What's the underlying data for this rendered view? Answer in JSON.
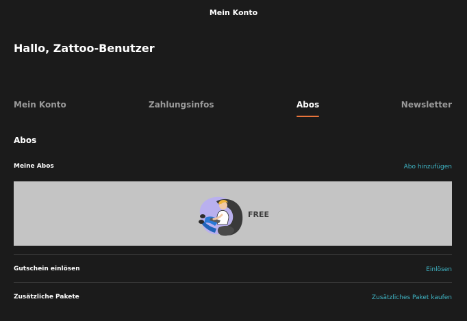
{
  "header": {
    "title": "Mein Konto"
  },
  "greeting": "Hallo, Zattoo-Benutzer",
  "tabs": [
    {
      "label": "Mein Konto",
      "active": false
    },
    {
      "label": "Zahlungsinfos",
      "active": false
    },
    {
      "label": "Abos",
      "active": true
    },
    {
      "label": "Newsletter",
      "active": false
    }
  ],
  "section": {
    "title": "Abos",
    "my_subs_label": "Meine Abos",
    "add_sub_link": "Abo hinzufügen"
  },
  "subscription": {
    "name": "FREE",
    "illustration_icon": "person-in-armchair-illustration"
  },
  "rows": [
    {
      "label": "Gutschein einlösen",
      "action": "Einlösen"
    },
    {
      "label": "Zusätzliche Pakete",
      "action": "Zusätzliches Paket kaufen"
    }
  ],
  "colors": {
    "background": "#1b1b1b",
    "accent_underline": "#e8743b",
    "link": "#3fb6c6",
    "card_background": "#c4c4c4",
    "inactive_tab": "#9a9a9a"
  }
}
